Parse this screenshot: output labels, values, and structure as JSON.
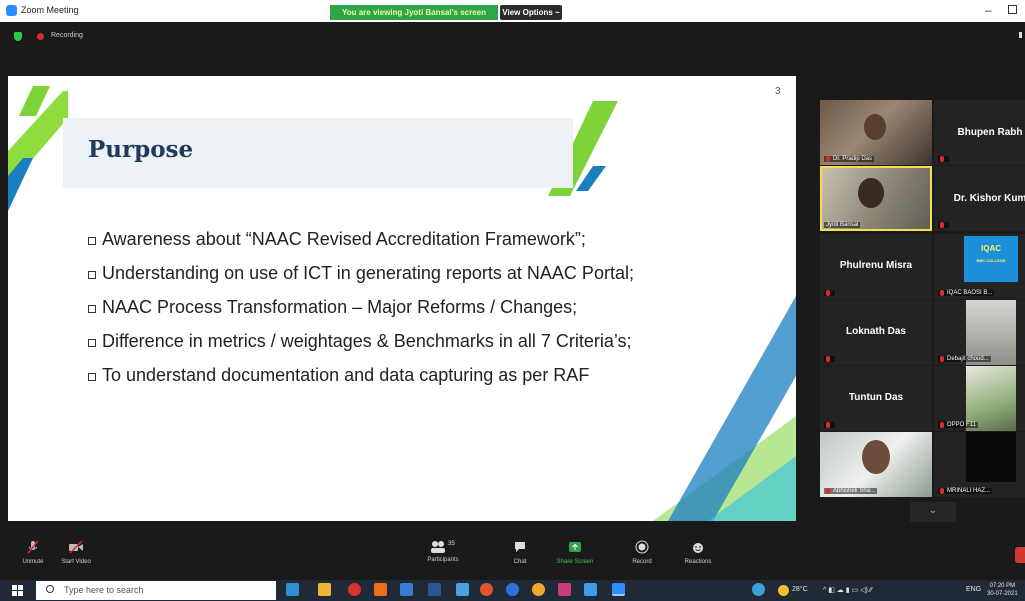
{
  "window": {
    "title": "Zoom Meeting",
    "viewing_banner": "You are viewing Jyoti Bansal's screen",
    "view_options": "View Options ~",
    "recording_label": "Recording"
  },
  "slide": {
    "number": "3",
    "title": "Purpose",
    "bullets": [
      "Awareness about “NAAC Revised Accreditation Framework”;",
      "Understanding on use of ICT in generating reports at NAAC Portal;",
      "NAAC Process Transformation – Major Reforms / Changes;",
      "Difference in metrics / weightages & Benchmarks in all 7 Criteria’s;",
      "To understand documentation and data capturing as per RAF"
    ]
  },
  "participants": {
    "p1": "Dr. Pradip Das",
    "p2": "Bhupen Rabh",
    "p3": "Jyoti Bansal",
    "p4": "Dr. Kishor Kum",
    "p5": "Phulrenu Misra",
    "p6_logo": "IQAC",
    "p6_logo_sub": "BBK COLLEGE",
    "p6": "IQAC BAOSI B...",
    "p7": "Loknath Das",
    "p8": "Debajit choud...",
    "p9": "Tuntun Das",
    "p10": "OPPO F11",
    "p11": "Abhishek Sha...",
    "p12": "MRINALI HAZ..."
  },
  "controls": {
    "unmute": "Unmute",
    "start_video": "Start Video",
    "participants": "Participants",
    "participants_count": "35",
    "chat": "Chat",
    "share_screen": "Share Screen",
    "record": "Record",
    "reactions": "Reactions"
  },
  "taskbar": {
    "search_placeholder": "Type here to search",
    "temperature": "28°C",
    "language": "ENG",
    "time": "07:20 PM",
    "date": "30-07-2021"
  },
  "colors": {
    "slide_accent_green": "#7ed33a",
    "slide_accent_blue": "#1a7fc1",
    "share_green": "#2ea54a",
    "zoom_blue": "#2d8cff"
  }
}
